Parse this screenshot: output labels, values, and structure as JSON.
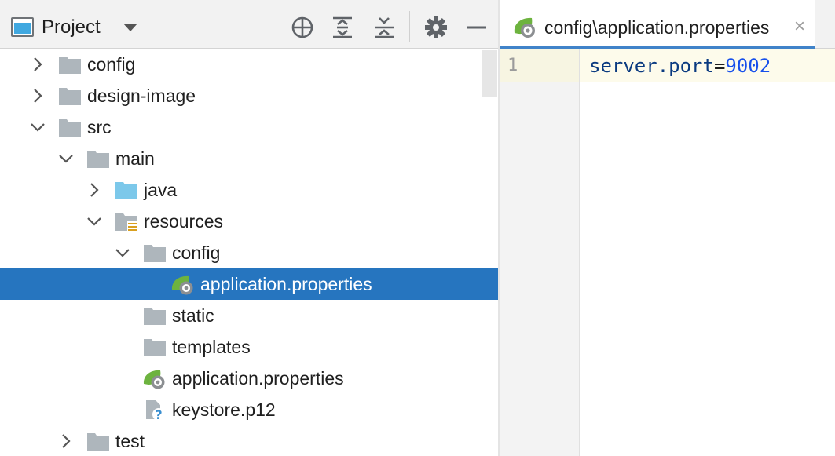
{
  "project_panel": {
    "title": "Project",
    "toolbar": [
      {
        "name": "locate-icon"
      },
      {
        "name": "expand-all-icon"
      },
      {
        "name": "collapse-all-icon"
      },
      {
        "name": "gear-icon"
      },
      {
        "name": "minimize-icon"
      }
    ],
    "tree": [
      {
        "label": "config",
        "icon": "folder",
        "chevron": "right",
        "depth": 0,
        "selected": false
      },
      {
        "label": "design-image",
        "icon": "folder",
        "chevron": "right",
        "depth": 0,
        "selected": false
      },
      {
        "label": "src",
        "icon": "folder",
        "chevron": "down",
        "depth": 0,
        "selected": false
      },
      {
        "label": "main",
        "icon": "folder",
        "chevron": "down",
        "depth": 1,
        "selected": false
      },
      {
        "label": "java",
        "icon": "source-folder",
        "chevron": "right",
        "depth": 2,
        "selected": false
      },
      {
        "label": "resources",
        "icon": "resources-folder",
        "chevron": "down",
        "depth": 2,
        "selected": false
      },
      {
        "label": "config",
        "icon": "folder",
        "chevron": "down",
        "depth": 3,
        "selected": false
      },
      {
        "label": "application.properties",
        "icon": "spring-properties",
        "chevron": "none",
        "depth": 4,
        "selected": true
      },
      {
        "label": "static",
        "icon": "folder",
        "chevron": "none",
        "depth": 3,
        "selected": false
      },
      {
        "label": "templates",
        "icon": "folder",
        "chevron": "none",
        "depth": 3,
        "selected": false
      },
      {
        "label": "application.properties",
        "icon": "spring-properties",
        "chevron": "none",
        "depth": 3,
        "selected": false
      },
      {
        "label": "keystore.p12",
        "icon": "unknown-file",
        "chevron": "none",
        "depth": 3,
        "selected": false
      },
      {
        "label": "test",
        "icon": "folder",
        "chevron": "right",
        "depth": 1,
        "selected": false
      }
    ]
  },
  "editor": {
    "tab": {
      "label": "config\\application.properties",
      "close_glyph": "×",
      "icon": "spring-properties"
    },
    "lines": [
      {
        "number": "1",
        "key": "server.port",
        "separator": "=",
        "value": "9002"
      }
    ]
  },
  "colors": {
    "selection": "#2675bf",
    "tab_accent": "#4083c9",
    "folder": "#aeb6bc",
    "source_folder": "#7cc8ea",
    "spring_green": "#6db33f",
    "code_key": "#0a3a80",
    "code_value": "#1750eb"
  }
}
